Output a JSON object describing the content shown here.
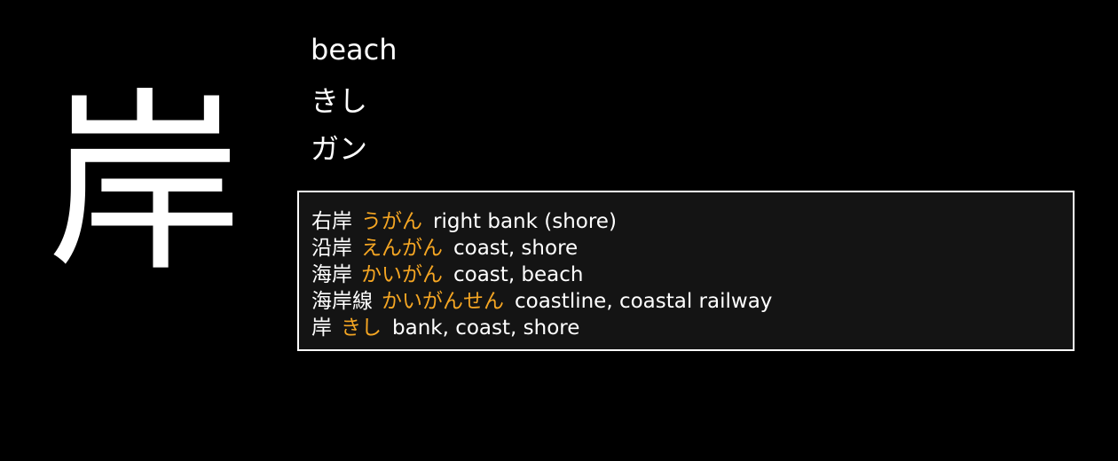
{
  "kanji": "岸",
  "meaning": "beach",
  "kun_reading": "きし",
  "on_reading": "ガン",
  "colors": {
    "background": "#000000",
    "text": "#ffffff",
    "reading_accent": "#f5a623",
    "box_background": "#141414",
    "box_border": "#ffffff"
  },
  "vocab": [
    {
      "word": "右岸",
      "reading": "うがん",
      "meaning": "right bank (shore)"
    },
    {
      "word": "沿岸",
      "reading": "えんがん",
      "meaning": "coast, shore"
    },
    {
      "word": "海岸",
      "reading": "かいがん",
      "meaning": "coast, beach"
    },
    {
      "word": "海岸線",
      "reading": "かいがんせん",
      "meaning": "coastline, coastal railway"
    },
    {
      "word": "岸",
      "reading": "きし",
      "meaning": "bank, coast, shore"
    }
  ]
}
